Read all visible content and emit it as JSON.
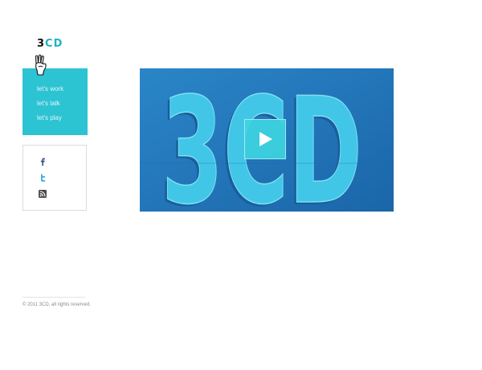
{
  "brand": {
    "logo_number": "3",
    "logo_letters": "CD",
    "accent_color": "#2cc3d3"
  },
  "nav": {
    "items": [
      {
        "label": "let's work"
      },
      {
        "label": "let's talk"
      },
      {
        "label": "let's play"
      }
    ]
  },
  "social": {
    "items": [
      {
        "icon": "facebook-icon"
      },
      {
        "icon": "twitter-icon"
      },
      {
        "icon": "rss-icon"
      }
    ]
  },
  "video": {
    "poster_text": "3CD",
    "play_icon": "play-icon",
    "poster_color": "#1f73b8"
  },
  "footer": {
    "copyright": "© 2011 3CD, all rights reserved."
  }
}
